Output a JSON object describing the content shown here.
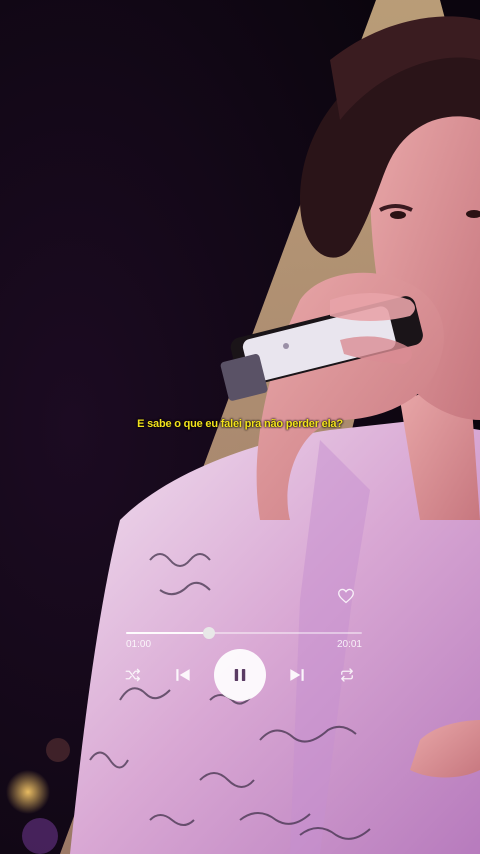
{
  "subtitle": "E sabe o que eu falei pra não perder ela?",
  "player": {
    "elapsed": "01:00",
    "duration": "20:01",
    "progress": 0.35,
    "liked": false,
    "state": "playing",
    "icons": {
      "like": "heart-outline-icon",
      "shuffle": "shuffle-icon",
      "previous": "skip-previous-icon",
      "play_pause": "pause-icon",
      "next": "skip-next-icon",
      "repeat": "repeat-icon"
    }
  },
  "colors": {
    "subtitle": "#f2e21c",
    "background": "#0f0712",
    "controls": "#ffffff"
  }
}
